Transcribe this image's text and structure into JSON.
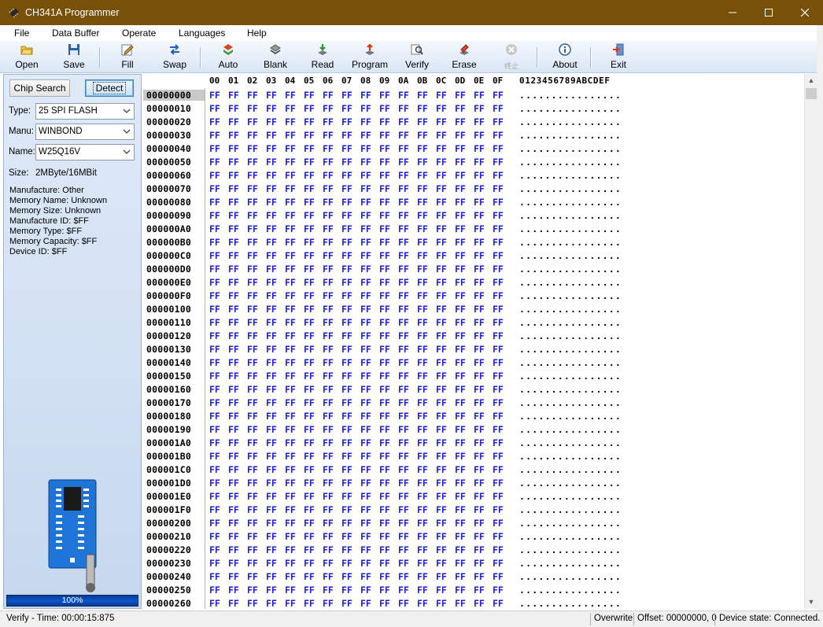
{
  "window": {
    "title": "CH341A Programmer"
  },
  "menu": [
    "File",
    "Data Buffer",
    "Operate",
    "Languages",
    "Help"
  ],
  "toolbar": {
    "open": "Open",
    "save": "Save",
    "fill": "Fill",
    "swap": "Swap",
    "auto": "Auto",
    "blank": "Blank",
    "read": "Read",
    "program": "Program",
    "verify": "Verify",
    "erase": "Erase",
    "stop": "终止",
    "about": "About",
    "exit": "Exit"
  },
  "left": {
    "chip_search": "Chip Search",
    "detect": "Detect",
    "type_label": "Type:",
    "type_value": "25 SPI FLASH",
    "manu_label": "Manu:",
    "manu_value": "WINBOND",
    "name_label": "Name:",
    "name_value": "W25Q16V",
    "size_label": "Size:",
    "size_value": "2MByte/16MBit",
    "info": [
      "Manufacture: Other",
      "Memory Name: Unknown",
      "Memory Size: Unknown",
      "Manufacture ID: $FF",
      "Memory Type: $FF",
      "Memory Capacity: $FF",
      "Device ID: $FF"
    ],
    "progress": "100%"
  },
  "hex": {
    "columns": [
      "00",
      "01",
      "02",
      "03",
      "04",
      "05",
      "06",
      "07",
      "08",
      "09",
      "0A",
      "0B",
      "0C",
      "0D",
      "0E",
      "0F"
    ],
    "ascii_header": "0123456789ABCDEF",
    "addresses": [
      "00000000",
      "00000010",
      "00000020",
      "00000030",
      "00000040",
      "00000050",
      "00000060",
      "00000070",
      "00000080",
      "00000090",
      "000000A0",
      "000000B0",
      "000000C0",
      "000000D0",
      "000000E0",
      "000000F0",
      "00000100",
      "00000110",
      "00000120",
      "00000130",
      "00000140",
      "00000150",
      "00000160",
      "00000170",
      "00000180",
      "00000190",
      "000001A0",
      "000001B0",
      "000001C0",
      "000001D0",
      "000001E0",
      "000001F0",
      "00000200",
      "00000210",
      "00000220",
      "00000230",
      "00000240",
      "00000250",
      "00000260"
    ],
    "byte_value": "FF",
    "ascii_row": "................"
  },
  "status": {
    "left": "Verify - Time: 00:00:15:875",
    "mode": "Overwrite",
    "offset": "Offset: 00000000, 0",
    "device": "Device state: Connected."
  },
  "colors": {
    "titlebar": "#77500a",
    "hex_bytes": "#1f1fd8",
    "progress": "#0a57d0"
  }
}
